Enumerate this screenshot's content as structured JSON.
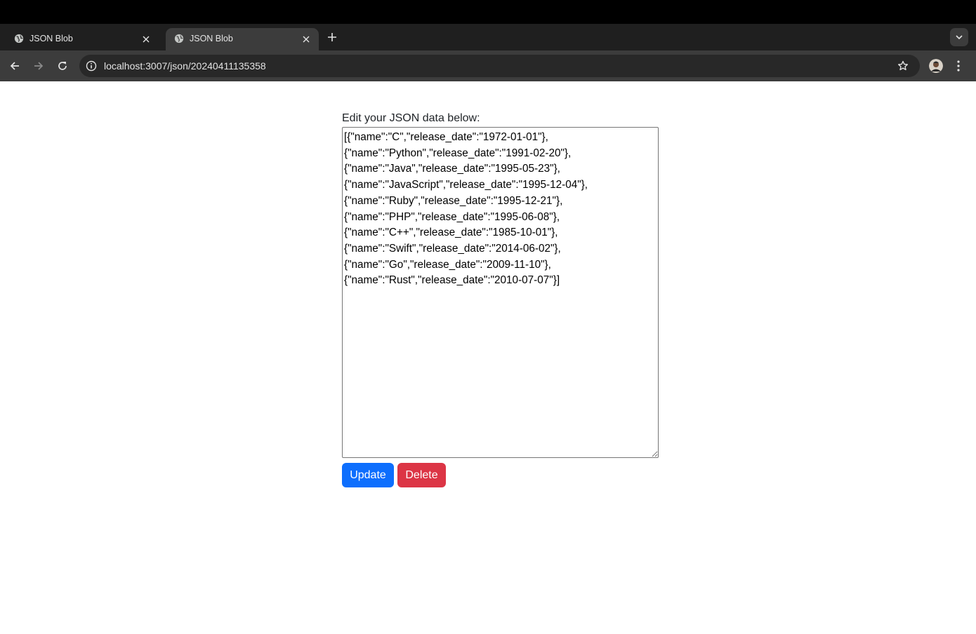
{
  "browser": {
    "tabs": [
      {
        "title": "JSON Blob",
        "active": false
      },
      {
        "title": "JSON Blob",
        "active": true
      }
    ],
    "url": "localhost:3007/json/20240411135358",
    "icons": [
      "globe-icon",
      "close-icon",
      "plus-icon",
      "chevron-down-icon",
      "back-arrow-icon",
      "forward-arrow-icon",
      "reload-icon",
      "info-icon",
      "star-icon",
      "avatar",
      "kebab-menu-icon"
    ]
  },
  "page": {
    "label": "Edit your JSON data below:",
    "json_text": "[{\"name\":\"C\",\"release_date\":\"1972-01-01\"},\n{\"name\":\"Python\",\"release_date\":\"1991-02-20\"},\n{\"name\":\"Java\",\"release_date\":\"1995-05-23\"},\n{\"name\":\"JavaScript\",\"release_date\":\"1995-12-04\"},\n{\"name\":\"Ruby\",\"release_date\":\"1995-12-21\"},\n{\"name\":\"PHP\",\"release_date\":\"1995-06-08\"},\n{\"name\":\"C++\",\"release_date\":\"1985-10-01\"},\n{\"name\":\"Swift\",\"release_date\":\"2014-06-02\"},\n{\"name\":\"Go\",\"release_date\":\"2009-11-10\"},\n{\"name\":\"Rust\",\"release_date\":\"2010-07-07\"}]",
    "update_label": "Update",
    "delete_label": "Delete"
  },
  "colors": {
    "update_button": "#0d6efd",
    "delete_button": "#dc3545",
    "toolbar": "#3c3c3c",
    "tabstrip": "#1f1f1f"
  }
}
